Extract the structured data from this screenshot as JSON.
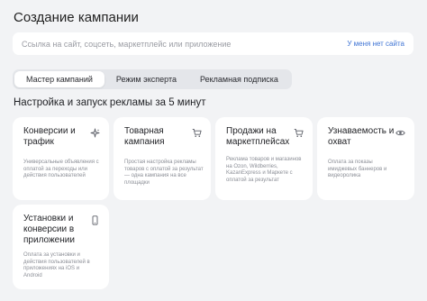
{
  "page": {
    "title": "Создание кампании"
  },
  "url_input": {
    "placeholder": "Ссылка на сайт, соцсеть, маркетплейс или приложение",
    "no_site_label": "У меня нет сайта"
  },
  "tabs": [
    {
      "label": "Мастер кампаний",
      "active": true
    },
    {
      "label": "Режим эксперта",
      "active": false
    },
    {
      "label": "Рекламная подписка",
      "active": false
    }
  ],
  "section_title": "Настройка и запуск рекламы за 5 минут",
  "cards": [
    {
      "title": "Конверсии и трафик",
      "icon": "sparkle-icon",
      "description": "Универсальные объявления с оплатой за переходы или действия пользователей"
    },
    {
      "title": "Товарная кампания",
      "icon": "cart-icon",
      "description": "Простая настройка рекламы товаров с оплатой за результат — одна кампания на все площадки"
    },
    {
      "title": "Продажи на маркетплейсах",
      "icon": "cart-icon",
      "description": "Реклама товаров и магазинов на Ozon, Wildberries, KazanExpress и Маркете с оплатой за результат"
    },
    {
      "title": "Узнаваемость и охват",
      "icon": "eye-icon",
      "description": "Оплата за показы имиджевых баннеров и видеоролика"
    },
    {
      "title": "Установки и конверсии в приложении",
      "icon": "phone-icon",
      "description": "Оплата за установки и действия пользователей в приложениях на iOS и Android"
    }
  ]
}
